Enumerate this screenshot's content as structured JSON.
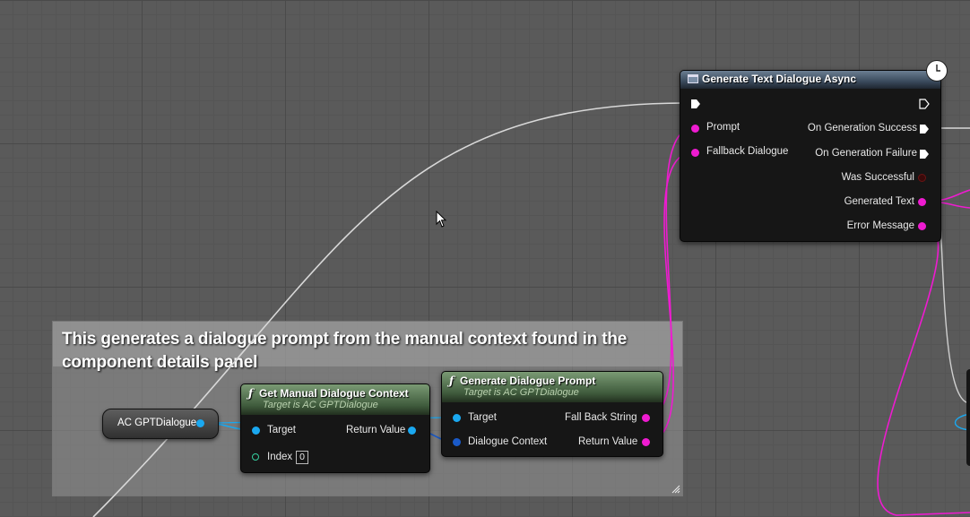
{
  "comment": {
    "text": "This generates a dialogue prompt from the manual context found in the component details panel"
  },
  "variable_node": {
    "label": "AC GPTDialogue"
  },
  "node_get_context": {
    "title": "Get Manual Dialogue Context",
    "subtitle": "Target is AC GPTDialogue",
    "pin_target": "Target",
    "pin_index": "Index",
    "index_value": "0",
    "pin_return": "Return Value"
  },
  "node_generate_prompt": {
    "title": "Generate Dialogue Prompt",
    "subtitle": "Target is AC GPTDialogue",
    "pin_target": "Target",
    "pin_context": "Dialogue Context",
    "pin_fallback": "Fall Back String",
    "pin_return": "Return Value"
  },
  "node_async": {
    "title": "Generate Text Dialogue Async",
    "pin_prompt": "Prompt",
    "pin_fallback": "Fallback Dialogue",
    "pin_success": "On Generation Success",
    "pin_failure": "On Generation Failure",
    "pin_was_successful": "Was Successful",
    "pin_generated_text": "Generated Text",
    "pin_error": "Error Message"
  },
  "colors": {
    "object_pin": "#1aa8f0",
    "string_pin": "#ee1bd0",
    "bool_pin": "#6a1414",
    "struct_pin": "#1a5ac8",
    "int_pin": "#36d0a0",
    "exec_wire": "#e0e0e0"
  },
  "icons": {
    "function": "function-icon",
    "event": "async-node-icon",
    "latent": "clock-icon",
    "cursor": "mouse-cursor-icon"
  }
}
